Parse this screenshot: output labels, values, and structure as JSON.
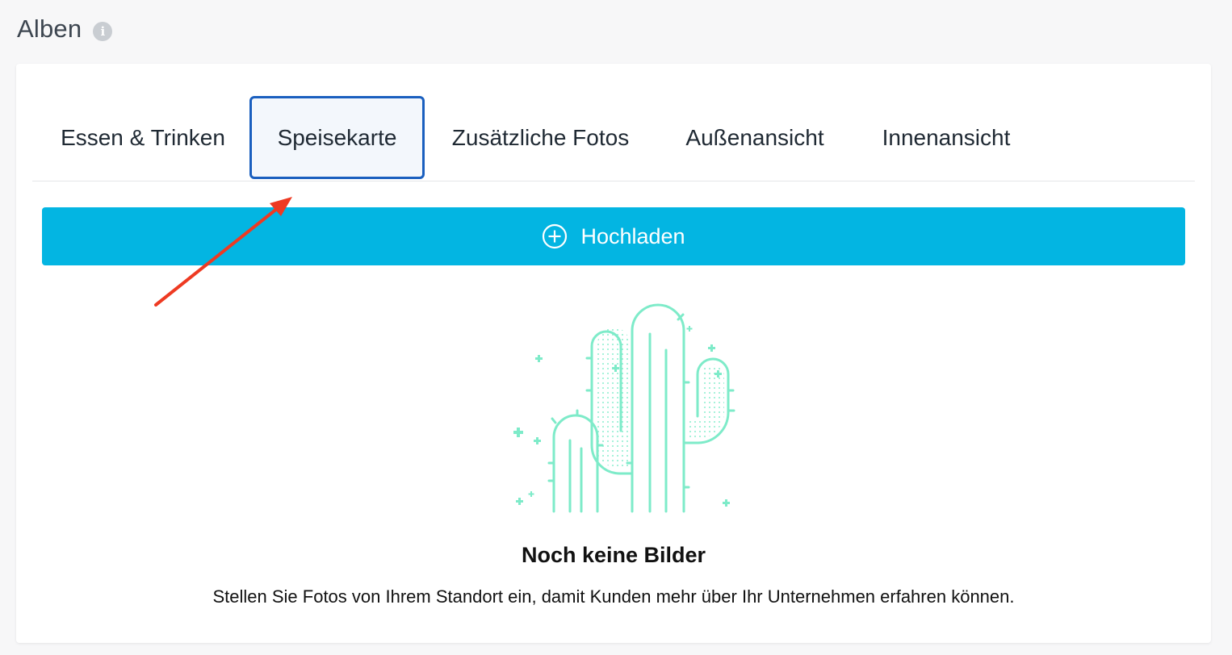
{
  "header": {
    "title": "Alben",
    "info_icon": "info-icon"
  },
  "tabs": [
    {
      "label": "Essen & Trinken",
      "active": false
    },
    {
      "label": "Speisekarte",
      "active": true
    },
    {
      "label": "Zusätzliche Fotos",
      "active": false
    },
    {
      "label": "Außenansicht",
      "active": false
    },
    {
      "label": "Innenansicht",
      "active": false
    }
  ],
  "upload": {
    "label": "Hochladen",
    "icon": "plus-circle-icon"
  },
  "empty_state": {
    "illustration": "cactus-illustration",
    "title": "Noch keine Bilder",
    "description": "Stellen Sie Fotos von Ihrem Standort ein, damit Kunden mehr über Ihr Unternehmen erfahren können."
  },
  "colors": {
    "accent": "#03b5e2",
    "active_tab_border": "#1a5fbf",
    "illustration": "#7eebc9",
    "annotation_arrow": "#ee3a22"
  }
}
